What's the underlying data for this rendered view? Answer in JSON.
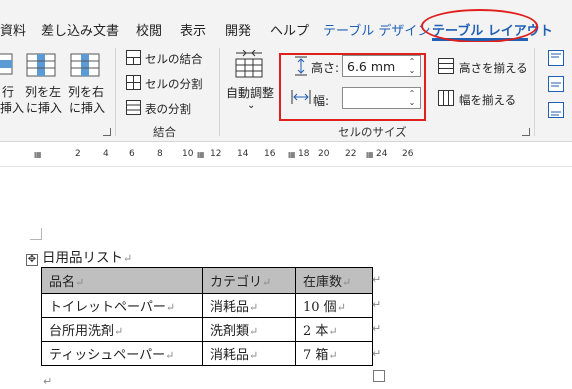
{
  "tabs": {
    "items": [
      "資料",
      "差し込み文書",
      "校閲",
      "表示",
      "開発",
      "ヘルプ",
      "テーブル デザイン",
      "テーブル レイアウト"
    ]
  },
  "ribbon": {
    "insert_group": {
      "left_partial": [
        "行",
        "挿入"
      ],
      "insert_left": [
        "列を左",
        "に挿入"
      ],
      "insert_right": [
        "列を右",
        "に挿入"
      ]
    },
    "merge_group": {
      "merge_cells": "セルの結合",
      "split_cells": "セルの分割",
      "split_table": "表の分割",
      "label": "結合"
    },
    "cell_size_group": {
      "autofit": "自動調整",
      "height_label": "高さ:",
      "height_value": "6.6 mm",
      "width_label": "幅:",
      "width_value": "",
      "distribute_rows": "高さを揃える",
      "distribute_cols": "幅を揃える",
      "label": "セルのサイズ"
    }
  },
  "ruler": {
    "ticks": [
      "2",
      "4",
      "6",
      "8",
      "10",
      "12",
      "14",
      "16",
      "18",
      "20",
      "22",
      "24",
      "26"
    ]
  },
  "document": {
    "title": "日用品リスト",
    "para_mark": "↵",
    "table": {
      "headers": [
        "品名",
        "カテゴリ",
        "在庫数"
      ],
      "rows": [
        [
          "トイレットペーパー",
          "消耗品",
          "10 個"
        ],
        [
          "台所用洗剤",
          "洗剤類",
          "2 本"
        ],
        [
          "ティッシュペーパー",
          "消耗品",
          "7 箱"
        ]
      ]
    }
  },
  "colors": {
    "accent": "#1f5fb4",
    "highlight": "#e0201c",
    "header_fill": "#bfbfbf"
  }
}
